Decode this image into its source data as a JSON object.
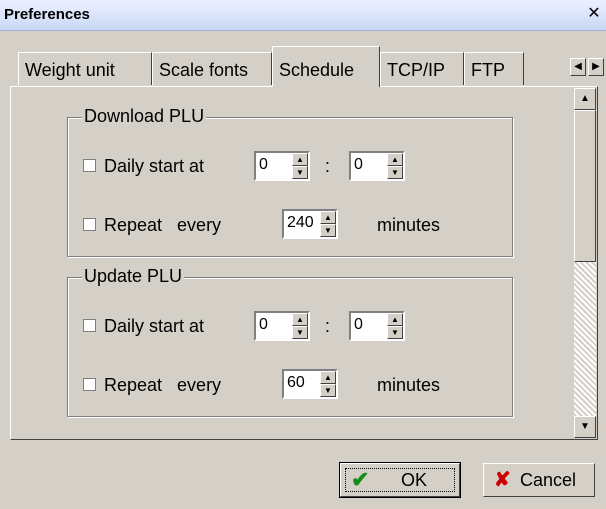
{
  "window": {
    "title": "Preferences",
    "close_glyph": "✕"
  },
  "tabs": [
    {
      "label": "Weight unit"
    },
    {
      "label": "Scale fonts"
    },
    {
      "label": "Schedule"
    },
    {
      "label": "TCP/IP"
    },
    {
      "label": "FTP"
    }
  ],
  "tab_scroll": {
    "left": "◀",
    "right": "▶"
  },
  "active_tab": "Schedule",
  "groups": [
    {
      "legend": "Download PLU",
      "daily_label": "Daily start at",
      "daily_hour": "0",
      "colon": ":",
      "daily_min": "0",
      "repeat_label": "Repeat   every",
      "repeat_value": "240",
      "minutes_label": "minutes"
    },
    {
      "legend": "Update PLU",
      "daily_label": "Daily start at",
      "daily_hour": "0",
      "colon": ":",
      "daily_min": "0",
      "repeat_label": "Repeat   every",
      "repeat_value": "60",
      "minutes_label": "minutes"
    }
  ],
  "scroll_glyphs": {
    "up": "▲",
    "down": "▼"
  },
  "buttons": {
    "ok_label": "OK",
    "cancel_label": "Cancel",
    "ok_icon": "✔",
    "cancel_icon": "✘"
  }
}
